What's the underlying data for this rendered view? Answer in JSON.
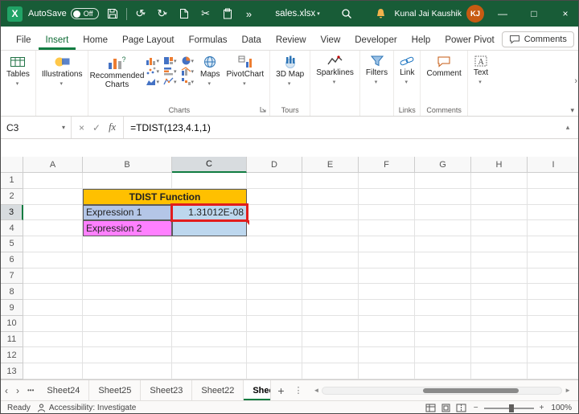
{
  "colors": {
    "titlebar": "#185C37",
    "accent_green": "#107C41",
    "avatar_orange": "#C75B12",
    "annotation_red": "#E11D1D"
  },
  "icons": {
    "excel_logo": "X",
    "chevron_down": "▾",
    "chevron_up": "▴",
    "undo": "↺",
    "redo": "↻",
    "cut": "✂",
    "more": "»",
    "minimize": "—",
    "maximize": "□",
    "close": "×",
    "cancel": "×",
    "check": "✓",
    "fx": "fx",
    "nav_left": "‹",
    "nav_right": "›",
    "ellipsis": "•••",
    "plus": "+",
    "kebab": "⋮",
    "scroll_left": "◄",
    "scroll_right": "►",
    "zoom_minus": "−",
    "zoom_plus": "+"
  },
  "titlebar": {
    "autosave_label": "AutoSave",
    "autosave_state": "Off",
    "filename": "sales.xlsx",
    "user_name": "Kunal Jai Kaushik",
    "user_initials": "KJ"
  },
  "menubar": {
    "tabs": [
      {
        "label": "File"
      },
      {
        "label": "Insert"
      },
      {
        "label": "Home"
      },
      {
        "label": "Page Layout"
      },
      {
        "label": "Formulas"
      },
      {
        "label": "Data"
      },
      {
        "label": "Review"
      },
      {
        "label": "View"
      },
      {
        "label": "Developer"
      },
      {
        "label": "Help"
      },
      {
        "label": "Power Pivot"
      }
    ],
    "active_tab": "Insert",
    "comments_button": "Comments"
  },
  "ribbon": {
    "tables": "Tables",
    "illustrations": "Illustrations",
    "recommended_charts": "Recommended Charts",
    "maps": "Maps",
    "pivotchart": "PivotChart",
    "charts_group": "Charts",
    "map_3d": "3D Map",
    "tours_group": "Tours",
    "sparklines": "Sparklines",
    "filters": "Filters",
    "link": "Link",
    "links_group": "Links",
    "comment": "Comment",
    "comments_group": "Comments",
    "text": "Text"
  },
  "formula_bar": {
    "name_box": "C3",
    "formula": "=TDIST(123,4.1,1)"
  },
  "grid": {
    "columns": [
      "A",
      "B",
      "C",
      "D",
      "E",
      "F",
      "G",
      "H",
      "I"
    ],
    "row_count": 13,
    "selected_column": "C",
    "selected_row": 3,
    "cells": [
      {
        "ref": "B2",
        "text": "TDIST Function",
        "span": 2,
        "bg": "#FFC000",
        "bold": true,
        "align": "center",
        "border": true
      },
      {
        "ref": "B3",
        "text": "Expression 1",
        "bg": "#B4C6E7",
        "align": "left",
        "border": true
      },
      {
        "ref": "C3",
        "text": "1.31012E-08",
        "bg": "#BDD7EE",
        "align": "right",
        "border": true,
        "annotated": true
      },
      {
        "ref": "B4",
        "text": "Expression 2",
        "bg": "#FF80FF",
        "align": "left",
        "border": true
      },
      {
        "ref": "C4",
        "text": "",
        "bg": "#BDD7EE",
        "border": true
      }
    ]
  },
  "sheet_tabs": {
    "tabs": [
      {
        "label": "Sheet24",
        "active": false
      },
      {
        "label": "Sheet25",
        "active": false
      },
      {
        "label": "Sheet23",
        "active": false
      },
      {
        "label": "Sheet22",
        "active": false
      },
      {
        "label": "Shee",
        "active": true
      }
    ]
  },
  "status_bar": {
    "ready": "Ready",
    "accessibility": "Accessibility: Investigate",
    "zoom": "100%"
  }
}
